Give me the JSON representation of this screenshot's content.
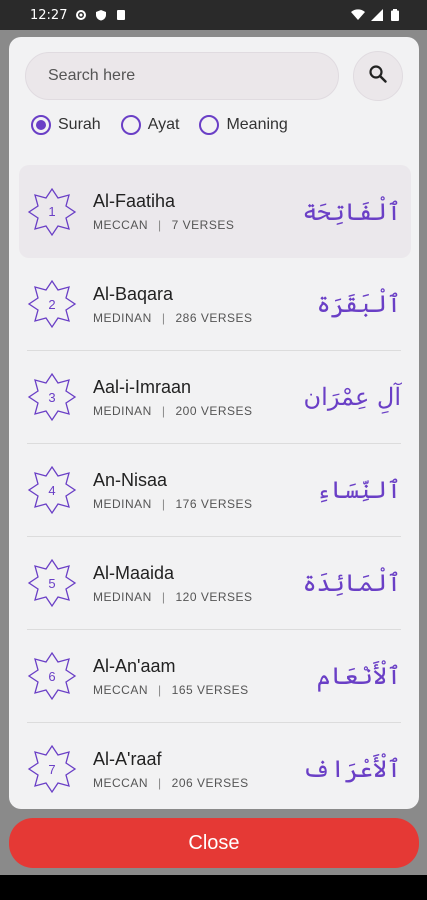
{
  "status_bar": {
    "time": "12:27"
  },
  "search": {
    "placeholder": "Search here"
  },
  "filter": {
    "options": [
      {
        "label": "Surah",
        "checked": true
      },
      {
        "label": "Ayat",
        "checked": false
      },
      {
        "label": "Meaning",
        "checked": false
      }
    ]
  },
  "surahs": [
    {
      "num": "1",
      "name": "Al-Faatiha",
      "type": "MECCAN",
      "verses": "7 VERSES",
      "arabic": "ٱلْفَاتِحَة"
    },
    {
      "num": "2",
      "name": "Al-Baqara",
      "type": "MEDINAN",
      "verses": "286 VERSES",
      "arabic": "ٱلْبَقَرَة"
    },
    {
      "num": "3",
      "name": "Aal-i-Imraan",
      "type": "MEDINAN",
      "verses": "200 VERSES",
      "arabic": "آلِ عِمْرَان"
    },
    {
      "num": "4",
      "name": "An-Nisaa",
      "type": "MEDINAN",
      "verses": "176 VERSES",
      "arabic": "ٱلنِّسَاءِ"
    },
    {
      "num": "5",
      "name": "Al-Maaida",
      "type": "MEDINAN",
      "verses": "120 VERSES",
      "arabic": "ٱلْمَائِدَة"
    },
    {
      "num": "6",
      "name": "Al-An'aam",
      "type": "MECCAN",
      "verses": "165 VERSES",
      "arabic": "ٱلْأَنْعَام"
    },
    {
      "num": "7",
      "name": "Al-A'raaf",
      "type": "MECCAN",
      "verses": "206 VERSES",
      "arabic": "ٱلْأَعْرَاف"
    }
  ],
  "meta_separator": "|",
  "close_label": "Close",
  "colors": {
    "accent": "#6a3fc6",
    "close": "#e53935"
  }
}
